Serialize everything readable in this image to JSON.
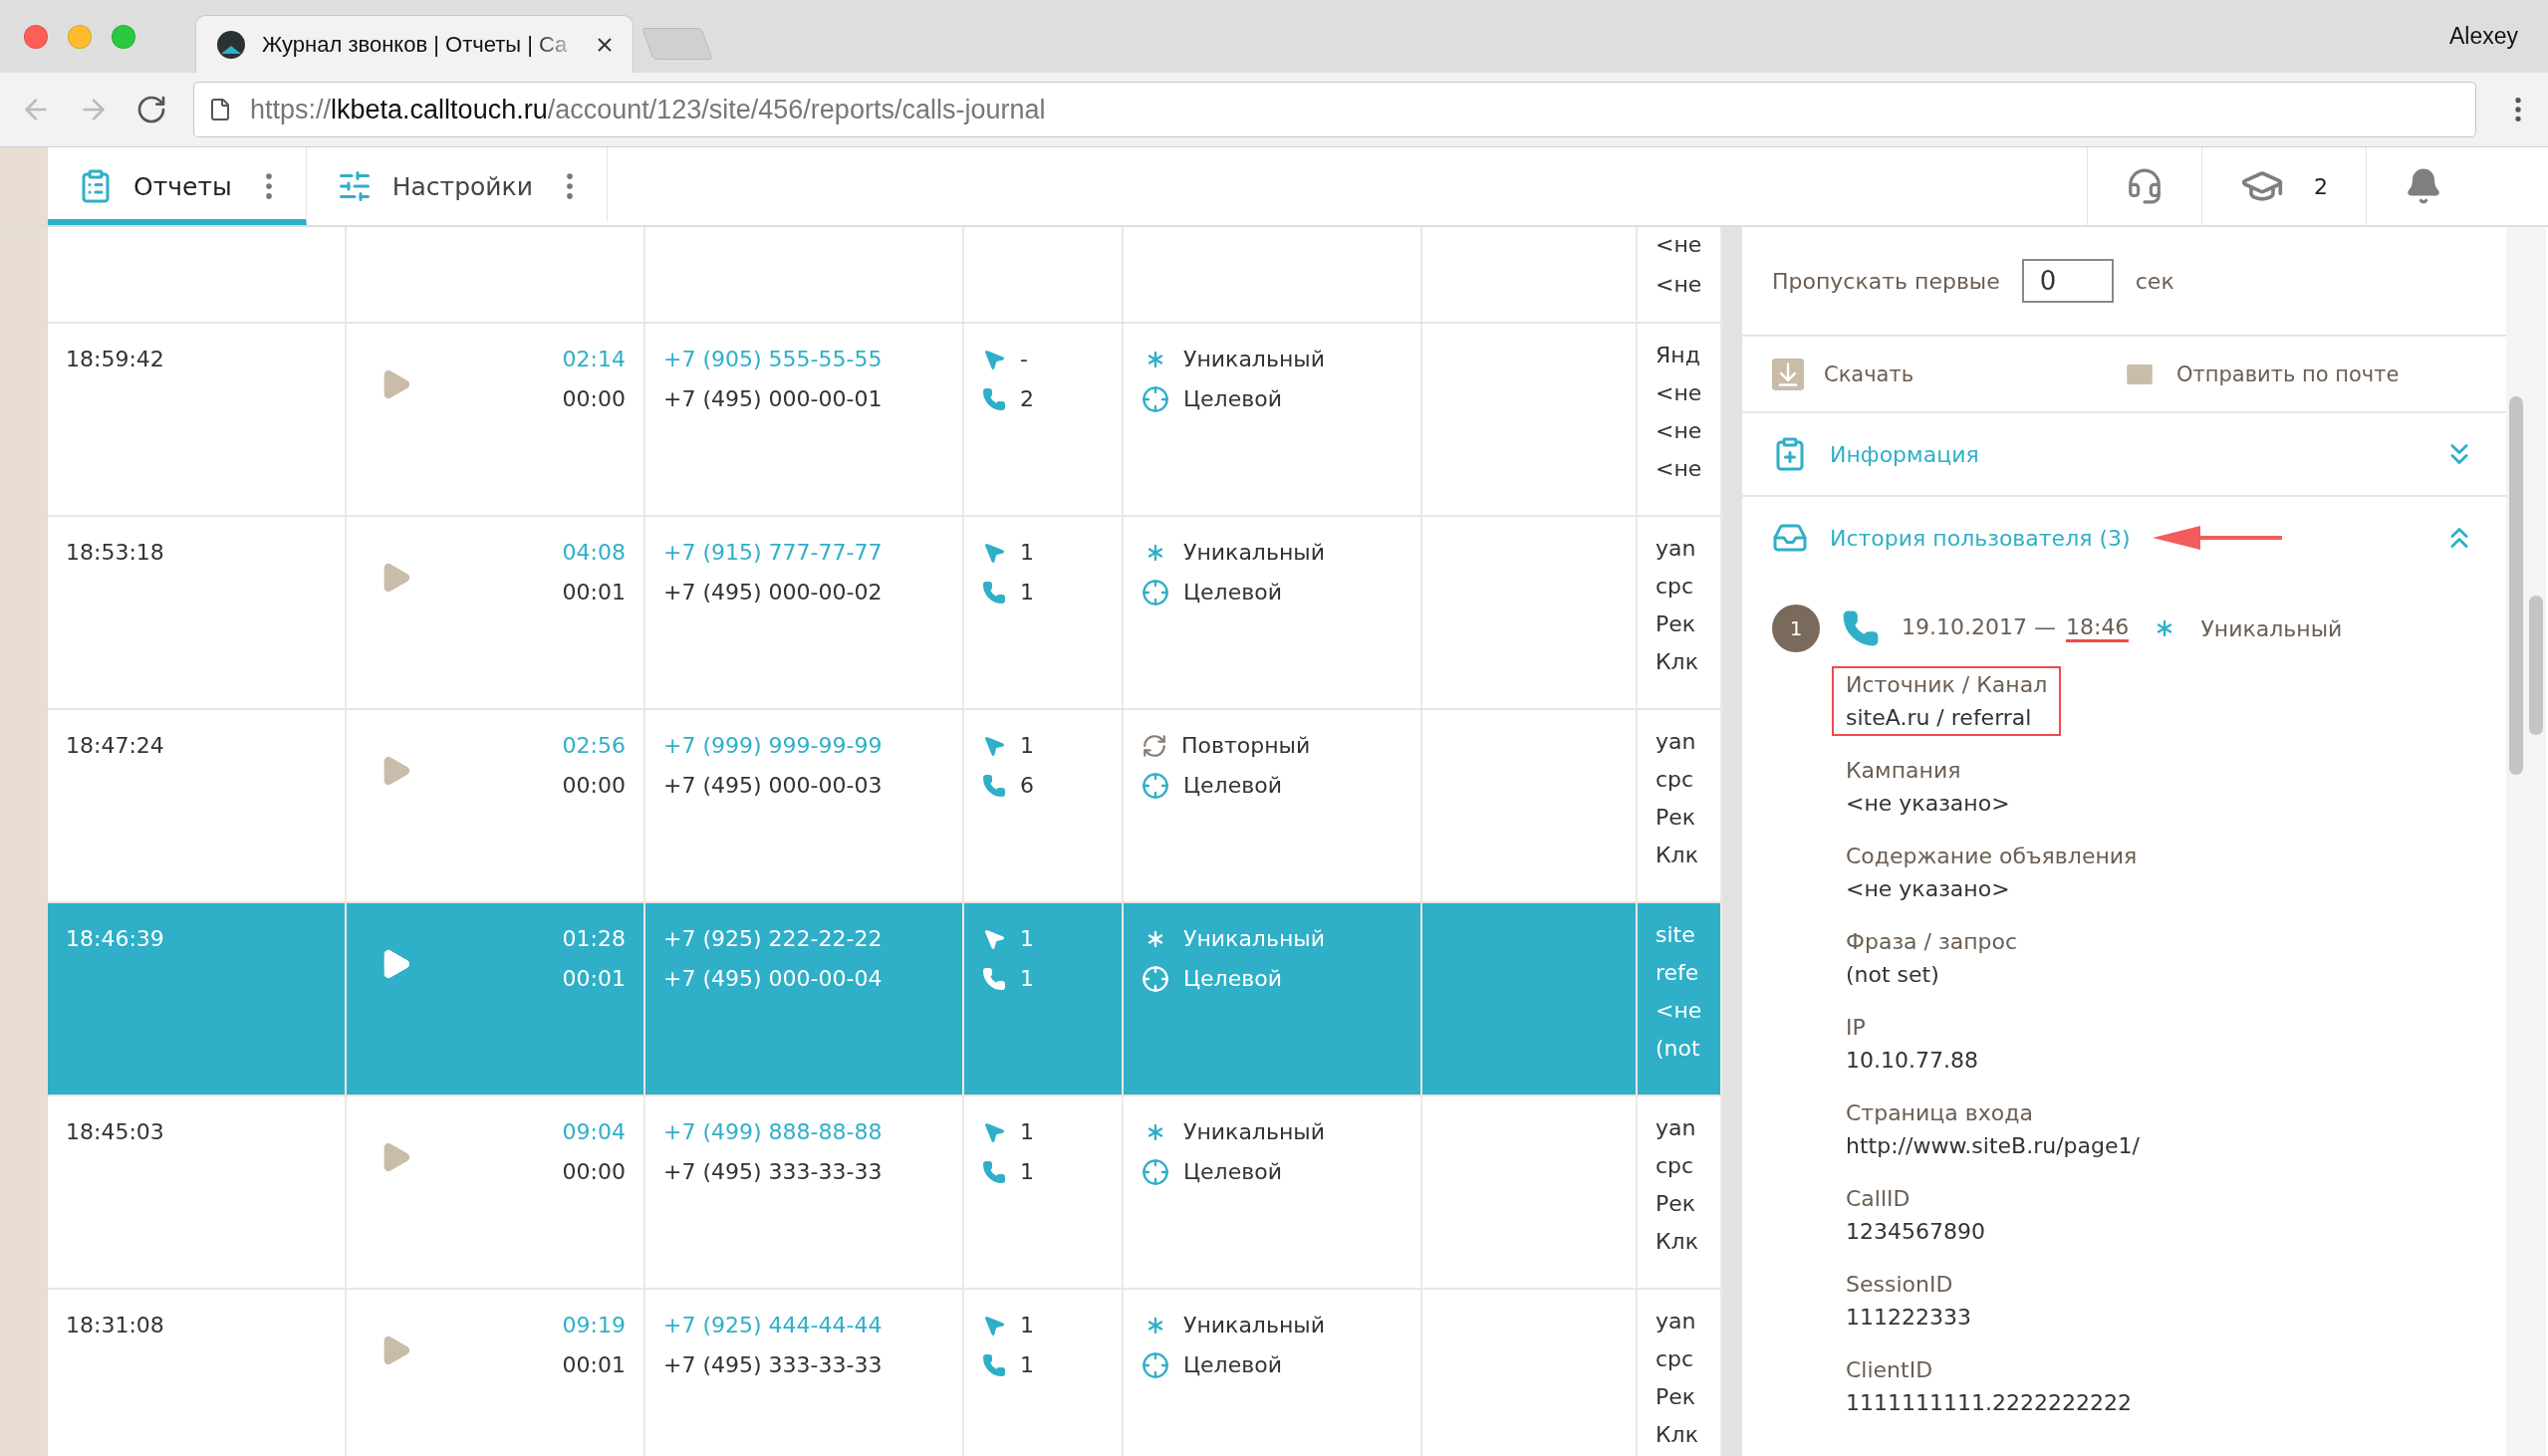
{
  "browser": {
    "tab_title": "Журнал звонков | Отчеты | Ca",
    "profile": "Alexey",
    "url_scheme": "https://",
    "url_host": "lkbeta.calltouch.ru",
    "url_path": "/account/123/site/456/reports/calls-journal"
  },
  "nav": {
    "tabs": [
      {
        "kind": "reports",
        "label": "Отчеты",
        "selected": true
      },
      {
        "kind": "settings",
        "label": "Настройки",
        "selected": false
      }
    ],
    "courses_count": "2"
  },
  "table": {
    "partial_row": {
      "column_7": [
        "<не",
        "<не"
      ]
    },
    "rows": [
      {
        "time": "18:59:42",
        "duration_1": "02:14",
        "duration_2": "00:00",
        "phone_1": "+7 (905) 555-55-55",
        "phone_2": "+7 (495) 000-00-01",
        "clicks": "-",
        "calls": "2",
        "tags": [
          {
            "kind": "unique",
            "label": "Уникальный"
          },
          {
            "kind": "target",
            "label": "Целевой"
          }
        ],
        "column_7": [
          "Янд",
          "<не",
          "<не",
          "<не"
        ],
        "selected": false
      },
      {
        "time": "18:53:18",
        "duration_1": "04:08",
        "duration_2": "00:01",
        "phone_1": "+7 (915) 777-77-77",
        "phone_2": "+7 (495) 000-00-02",
        "clicks": "1",
        "calls": "1",
        "tags": [
          {
            "kind": "unique",
            "label": "Уникальный"
          },
          {
            "kind": "target",
            "label": "Целевой"
          }
        ],
        "column_7": [
          "yan",
          "cpc",
          "Рек",
          "Клк"
        ],
        "selected": false
      },
      {
        "time": "18:47:24",
        "duration_1": "02:56",
        "duration_2": "00:00",
        "phone_1": "+7 (999) 999-99-99",
        "phone_2": "+7 (495) 000-00-03",
        "clicks": "1",
        "calls": "6",
        "tags": [
          {
            "kind": "repeat",
            "label": "Повторный"
          },
          {
            "kind": "target",
            "label": "Целевой"
          }
        ],
        "column_7": [
          "yan",
          "cpc",
          "Рек",
          "Клк"
        ],
        "selected": false
      },
      {
        "time": "18:46:39",
        "duration_1": "01:28",
        "duration_2": "00:01",
        "phone_1": "+7 (925) 222-22-22",
        "phone_2": "+7 (495) 000-00-04",
        "clicks": "1",
        "calls": "1",
        "tags": [
          {
            "kind": "unique",
            "label": "Уникальный"
          },
          {
            "kind": "target",
            "label": "Целевой"
          }
        ],
        "column_7": [
          "site",
          "refe",
          "<не",
          "(not"
        ],
        "selected": true
      },
      {
        "time": "18:45:03",
        "duration_1": "09:04",
        "duration_2": "00:00",
        "phone_1": "+7 (499) 888-88-88",
        "phone_2": "+7 (495) 333-33-33",
        "clicks": "1",
        "calls": "1",
        "tags": [
          {
            "kind": "unique",
            "label": "Уникальный"
          },
          {
            "kind": "target",
            "label": "Целевой"
          }
        ],
        "column_7": [
          "yan",
          "cpc",
          "Рек",
          "Клк"
        ],
        "selected": false
      },
      {
        "time": "18:31:08",
        "duration_1": "09:19",
        "duration_2": "00:01",
        "phone_1": "+7 (925) 444-44-44",
        "phone_2": "+7 (495) 333-33-33",
        "clicks": "1",
        "calls": "1",
        "tags": [
          {
            "kind": "unique",
            "label": "Уникальный"
          },
          {
            "kind": "target",
            "label": "Целевой"
          }
        ],
        "column_7": [
          "yan",
          "cpc",
          "Рек",
          "Клк"
        ],
        "selected": false
      }
    ]
  },
  "panel": {
    "skip_label": "Пропускать первые",
    "skip_value": "0",
    "skip_unit": "сек",
    "actions": [
      {
        "kind": "download",
        "label": "Скачать"
      },
      {
        "kind": "mail",
        "label": "Отправить по почте"
      }
    ],
    "sections": [
      {
        "kind": "info",
        "title": "Информация",
        "expanded": false,
        "annotated": false
      },
      {
        "kind": "history",
        "title": "История пользователя (3)",
        "expanded": true,
        "annotated": true
      }
    ],
    "history": [
      {
        "number": "1",
        "date": "19.10.2017 —",
        "time": "18:46",
        "time_underlined": true,
        "status": "Уникальный",
        "fields": [
          {
            "label": "Источник / Канал",
            "value": "siteA.ru / referral",
            "highlighted": true
          },
          {
            "label": "Кампания",
            "value": "<не указано>",
            "highlighted": false
          },
          {
            "label": "Содержание объявления",
            "value": "<не указано>",
            "highlighted": false
          },
          {
            "label": "Фраза / запрос",
            "value": "(not set)",
            "highlighted": false
          },
          {
            "label": "IP",
            "value": "10.10.77.88",
            "highlighted": false
          },
          {
            "label": "Страница входа",
            "value": "http://www.siteB.ru/page1/",
            "highlighted": false
          },
          {
            "label": "CallID",
            "value": "1234567890",
            "highlighted": false
          },
          {
            "label": "SessionID",
            "value": "111222333",
            "highlighted": false
          },
          {
            "label": "ClientID",
            "value": "1111111111.2222222222",
            "highlighted": false
          }
        ]
      }
    ]
  }
}
